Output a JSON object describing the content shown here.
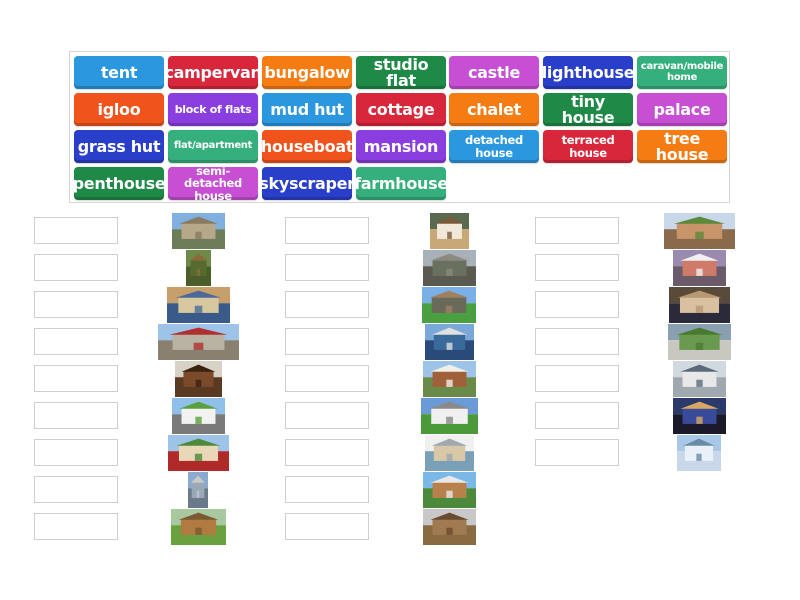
{
  "word_bank": {
    "tiles": [
      {
        "label": "tent",
        "color": "#2b97de"
      },
      {
        "label": "campervan",
        "color": "#d8263b"
      },
      {
        "label": "bungalow",
        "color": "#f57c12"
      },
      {
        "label": "studio flat",
        "color": "#1f8a47"
      },
      {
        "label": "castle",
        "color": "#c64fd3"
      },
      {
        "label": "lighthouse",
        "color": "#2a3fc9"
      },
      {
        "label": "caravan/mobile home",
        "color": "#35b07d"
      },
      {
        "label": "igloo",
        "color": "#f0531b"
      },
      {
        "label": "block of flats",
        "color": "#8a3ee0"
      },
      {
        "label": "mud hut",
        "color": "#2b97de"
      },
      {
        "label": "cottage",
        "color": "#d8263b"
      },
      {
        "label": "chalet",
        "color": "#f57c12"
      },
      {
        "label": "tiny house",
        "color": "#1f8a47"
      },
      {
        "label": "palace",
        "color": "#c64fd3"
      },
      {
        "label": "grass hut",
        "color": "#2a3fc9"
      },
      {
        "label": "flat/apartment",
        "color": "#35b07d"
      },
      {
        "label": "houseboat",
        "color": "#f0531b"
      },
      {
        "label": "mansion",
        "color": "#8a3ee0"
      },
      {
        "label": "detached house",
        "color": "#2b97de"
      },
      {
        "label": "terraced house",
        "color": "#d8263b"
      },
      {
        "label": "tree house",
        "color": "#f57c12"
      },
      {
        "label": "penthouse",
        "color": "#1f8a47"
      },
      {
        "label": "semi-detached house",
        "color": "#c64fd3"
      },
      {
        "label": "skyscraper",
        "color": "#2a3fc9"
      },
      {
        "label": "farmhouse",
        "color": "#35b07d"
      }
    ]
  },
  "match_items": [
    {
      "picture": "castle-photo",
      "answer": ""
    },
    {
      "picture": "tree-house-photo",
      "answer": ""
    },
    {
      "picture": "mansion-photo",
      "answer": ""
    },
    {
      "picture": "palace-photo",
      "answer": ""
    },
    {
      "picture": "grass-hut-photo",
      "answer": ""
    },
    {
      "picture": "caravan-photo",
      "answer": ""
    },
    {
      "picture": "bungalow-photo",
      "answer": ""
    },
    {
      "picture": "skyscraper-photo",
      "answer": ""
    },
    {
      "picture": "tiny-house-photo",
      "answer": ""
    },
    {
      "picture": "tent-photo",
      "answer": ""
    },
    {
      "picture": "block-of-flats-photo",
      "answer": ""
    },
    {
      "picture": "cottage-photo",
      "answer": ""
    },
    {
      "picture": "houseboat-photo",
      "answer": ""
    },
    {
      "picture": "chalet-photo",
      "answer": ""
    },
    {
      "picture": "campervan-photo",
      "answer": ""
    },
    {
      "picture": "flat-floorplan-photo",
      "answer": ""
    },
    {
      "picture": "detached-house-photo",
      "answer": ""
    },
    {
      "picture": "mud-hut-photo",
      "answer": ""
    },
    {
      "picture": "semi-detached-house-photo",
      "answer": ""
    },
    {
      "picture": "lighthouse-photo",
      "answer": ""
    },
    {
      "picture": "studio-flat-photo",
      "answer": ""
    },
    {
      "picture": "farmhouse-photo",
      "answer": ""
    },
    {
      "picture": "terraced-house-photo",
      "answer": ""
    },
    {
      "picture": "penthouse-photo",
      "answer": ""
    },
    {
      "picture": "igloo-photo",
      "answer": ""
    }
  ]
}
